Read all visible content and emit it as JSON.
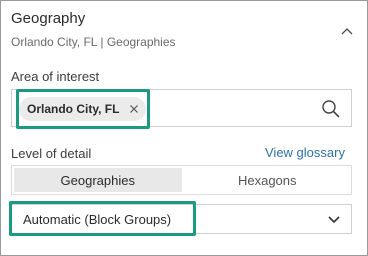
{
  "panel": {
    "title": "Geography",
    "subtitle": "Orlando City, FL | Geographies",
    "collapse_icon": "chevron-up-icon"
  },
  "area_of_interest": {
    "label": "Area of interest",
    "chip_label": "Orlando City, FL",
    "chip_remove_icon": "close-icon",
    "search_icon": "search-icon"
  },
  "level_of_detail": {
    "label": "Level of detail",
    "glossary_link": "View glossary",
    "tabs": [
      {
        "label": "Geographies",
        "selected": true
      },
      {
        "label": "Hexagons",
        "selected": false
      }
    ],
    "selected_option": "Automatic (Block Groups)",
    "dropdown_icon": "chevron-down-icon"
  },
  "colors": {
    "highlight": "#1a9a7e",
    "link": "#2a73a8",
    "active_tab": "#e8e8e8",
    "chip": "#ebebeb"
  }
}
